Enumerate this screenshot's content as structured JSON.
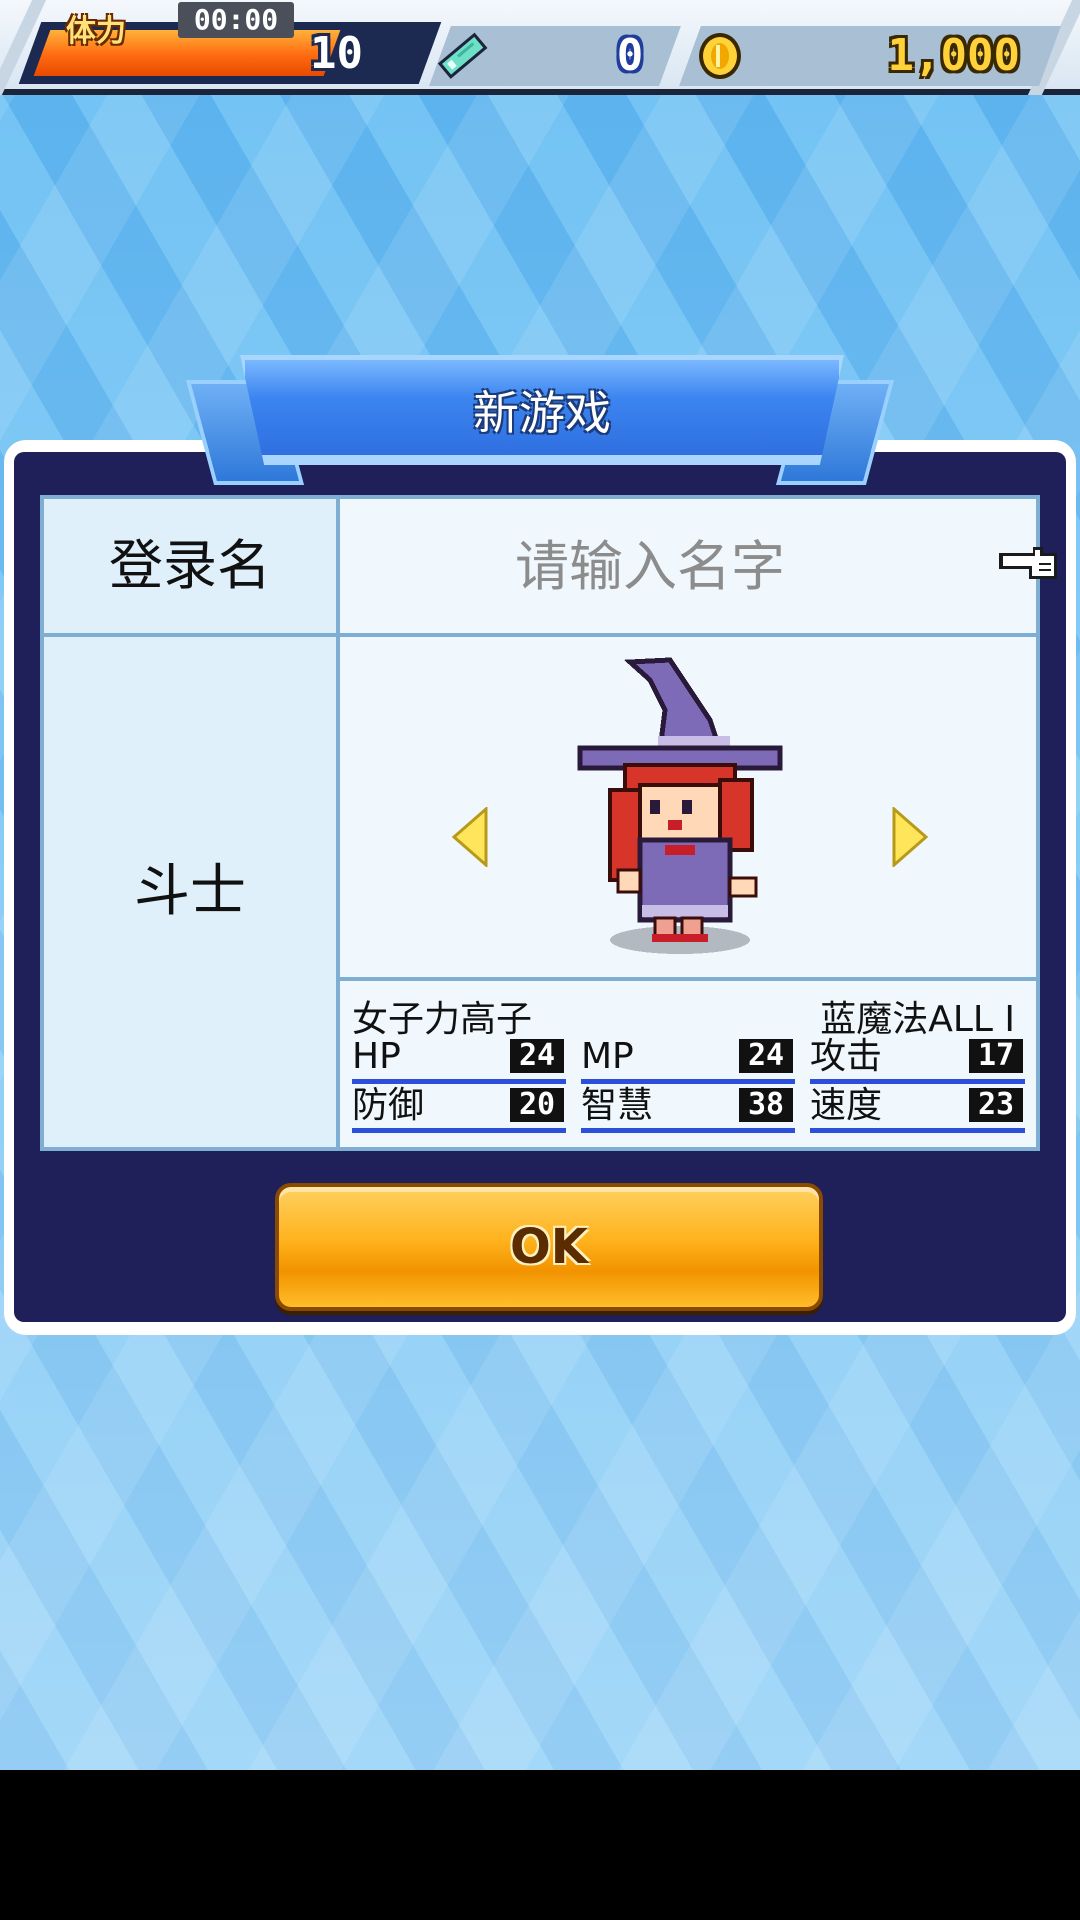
{
  "top_bar": {
    "stamina_label": "体力",
    "stamina_timer": "00:00",
    "stamina_value": "10",
    "ticket_icon": "ticket-icon",
    "ticket_value": "0",
    "coin_icon": "gold-coin-icon",
    "gold_value": "1,000"
  },
  "dialog": {
    "title": "新游戏",
    "name_label": "登录名",
    "name_placeholder": "请输入名字",
    "name_value": "",
    "class_name": "斗士",
    "character_desc": "女子力高子",
    "character_skill": "蓝魔法ALL Ⅰ",
    "stats": [
      {
        "label": "HP",
        "value": "24"
      },
      {
        "label": "MP",
        "value": "24"
      },
      {
        "label": "攻击",
        "value": "17"
      },
      {
        "label": "防御",
        "value": "20"
      },
      {
        "label": "智慧",
        "value": "38"
      },
      {
        "label": "速度",
        "value": "23"
      }
    ],
    "ok_label": "OK"
  },
  "colors": {
    "dialog_bg": "#1f1f5a",
    "title_banner": "#3c85f0",
    "ok_button": "#ffb21c",
    "stat_underline": "#2b4fd8",
    "stamina_bar": "#ff6a10"
  }
}
